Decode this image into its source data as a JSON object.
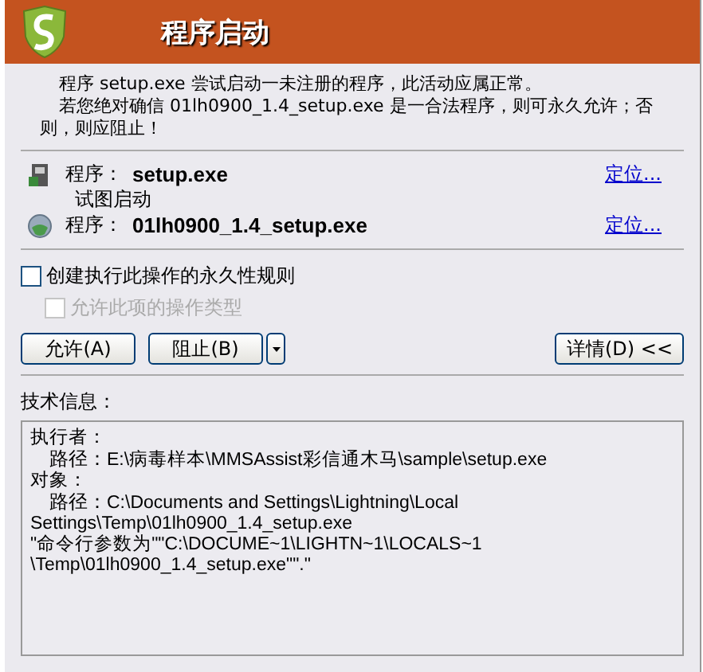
{
  "window": {
    "title": "程序启动"
  },
  "message": [
    "程序 setup.exe 尝试启动一未注册的程序，此活动应属正常。",
    "若您绝对确信 01lh0900_1.4_setup.exe 是一合法程序，则可永久允许；否则，则应阻止！"
  ],
  "actors": [
    {
      "kind": "installer",
      "label": "程序：",
      "name": "setup.exe",
      "link": "定位..."
    },
    {
      "kind": "globe",
      "label": "程序：",
      "name": "01lh0900_1.4_setup.exe",
      "link": "定位..."
    }
  ],
  "action": "试图启动",
  "options": [
    {
      "label": "创建执行此操作的永久性规则",
      "checked": false,
      "disabled": false
    },
    {
      "label": "允许此项的操作类型",
      "checked": false,
      "disabled": true
    }
  ],
  "buttons": {
    "allow": "允许(A)",
    "block": "阻止(B)",
    "details": "详情(D) <<"
  },
  "tech_info": {
    "title": "技术信息：",
    "lines": [
      {
        "kind": "heading",
        "text": "执行者："
      },
      {
        "kind": "path",
        "label": "路径：",
        "text": "E:\\病毒样本\\MMSAssist彩信通木马\\sample\\setup.exe"
      },
      {
        "kind": "heading",
        "text": "对象："
      },
      {
        "kind": "path",
        "label": "路径：",
        "text": "C:\\Documents and Settings\\Lightning\\Local"
      },
      {
        "kind": "wrap",
        "text": "Settings\\Temp\\01lh0900_1.4_setup.exe"
      },
      {
        "kind": "wrap",
        "text": "\"命令行参数为\"\"C:\\DOCUME~1\\LIGHTN~1\\LOCALS~1"
      },
      {
        "kind": "wrap",
        "text": "\\Temp\\01lh0900_1.4_setup.exe\"\".\""
      }
    ]
  }
}
